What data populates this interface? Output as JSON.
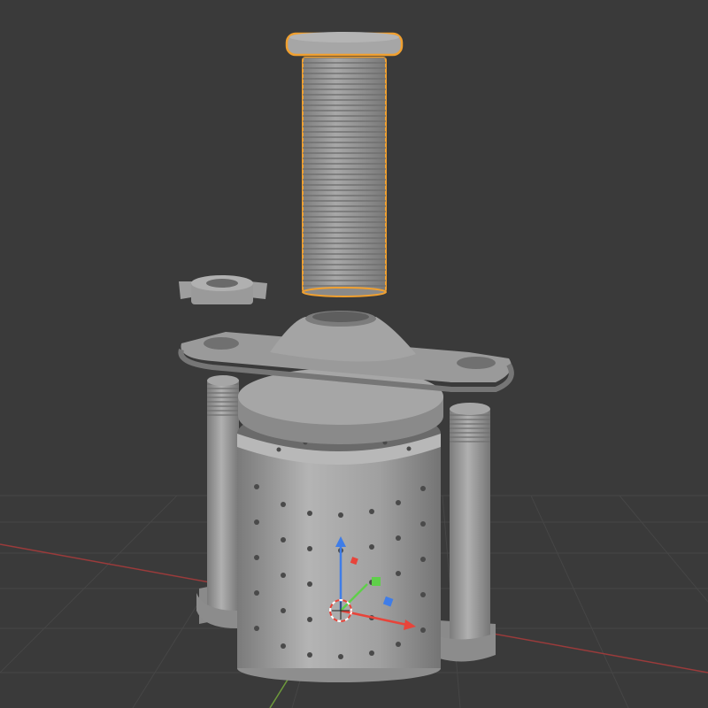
{
  "viewport": {
    "background": "#3a3a3a",
    "grid_color": "#464646",
    "x_axis_color": "#9a3b3b",
    "y_axis_color": "#6e9a3b"
  },
  "selection": {
    "selected_object": "threaded-bolt",
    "outline_color": "#f0a030"
  },
  "scene": {
    "objects": [
      {
        "name": "threaded-bolt",
        "selected": true
      },
      {
        "name": "wing-nut",
        "selected": false
      },
      {
        "name": "mounting-plate",
        "selected": false
      },
      {
        "name": "lid-disc",
        "selected": false
      },
      {
        "name": "perforated-cylinder",
        "selected": false
      },
      {
        "name": "threaded-post-left",
        "selected": false
      },
      {
        "name": "threaded-post-right",
        "selected": false
      }
    ],
    "material_color": "#9c9c9c"
  },
  "gizmo": {
    "x_color": "#e8443a",
    "y_color": "#5fcf4a",
    "z_color": "#3f7de8",
    "cursor": "3d-cursor-icon"
  }
}
